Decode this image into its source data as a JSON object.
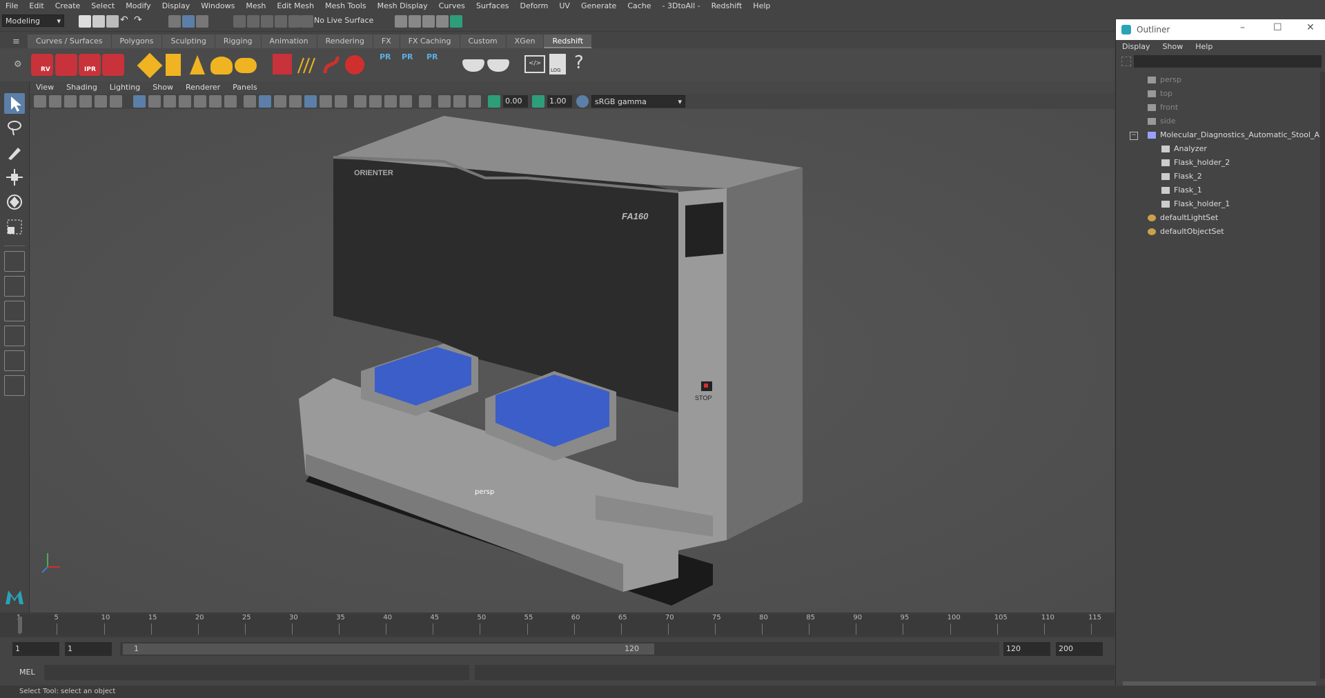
{
  "menubar": {
    "items": [
      "File",
      "Edit",
      "Create",
      "Select",
      "Modify",
      "Display",
      "Windows",
      "Mesh",
      "Edit Mesh",
      "Mesh Tools",
      "Mesh Display",
      "Curves",
      "Surfaces",
      "Deform",
      "UV",
      "Generate",
      "Cache",
      "- 3DtoAll -",
      "Redshift",
      "Help"
    ]
  },
  "statusline": {
    "workspace": "Modeling",
    "live_surface": "No Live Surface"
  },
  "shelf": {
    "tabs": [
      "Curves / Surfaces",
      "Polygons",
      "Sculpting",
      "Rigging",
      "Animation",
      "Rendering",
      "FX",
      "FX Caching",
      "Custom",
      "XGen",
      "Redshift"
    ],
    "active_tab": "Redshift",
    "icons": [
      "RV",
      "IPR",
      "PR",
      "LOG",
      "?"
    ]
  },
  "viewport": {
    "menu": [
      "View",
      "Shading",
      "Lighting",
      "Show",
      "Renderer",
      "Panels"
    ],
    "exposure": "0.00",
    "gamma": "1.00",
    "color_space": "sRGB gamma",
    "camera_label": "persp",
    "model_brand": "ORIENTER",
    "model_name": "FA160",
    "stop_label": "STOP"
  },
  "timeline": {
    "ticks": [
      "1",
      "5",
      "10",
      "15",
      "20",
      "25",
      "30",
      "35",
      "40",
      "45",
      "50",
      "55",
      "60",
      "65",
      "70",
      "75",
      "80",
      "85",
      "90",
      "95",
      "100",
      "105",
      "110",
      "115"
    ]
  },
  "range": {
    "start": "1",
    "current": "1",
    "slider_start": "1",
    "slider_end": "120",
    "anim_end": "120",
    "anim_max": "200"
  },
  "mel": {
    "label": "MEL"
  },
  "helpline": {
    "text": "Select Tool: select an object"
  },
  "outliner": {
    "title": "Outliner",
    "menu": [
      "Display",
      "Show",
      "Help"
    ],
    "cameras": [
      "persp",
      "top",
      "front",
      "side"
    ],
    "group": "Molecular_Diagnostics_Automatic_Stool_Ar",
    "children": [
      "Analyzer",
      "Flask_holder_2",
      "Flask_2",
      "Flask_1",
      "Flask_holder_1"
    ],
    "sets": [
      "defaultLightSet",
      "defaultObjectSet"
    ]
  }
}
